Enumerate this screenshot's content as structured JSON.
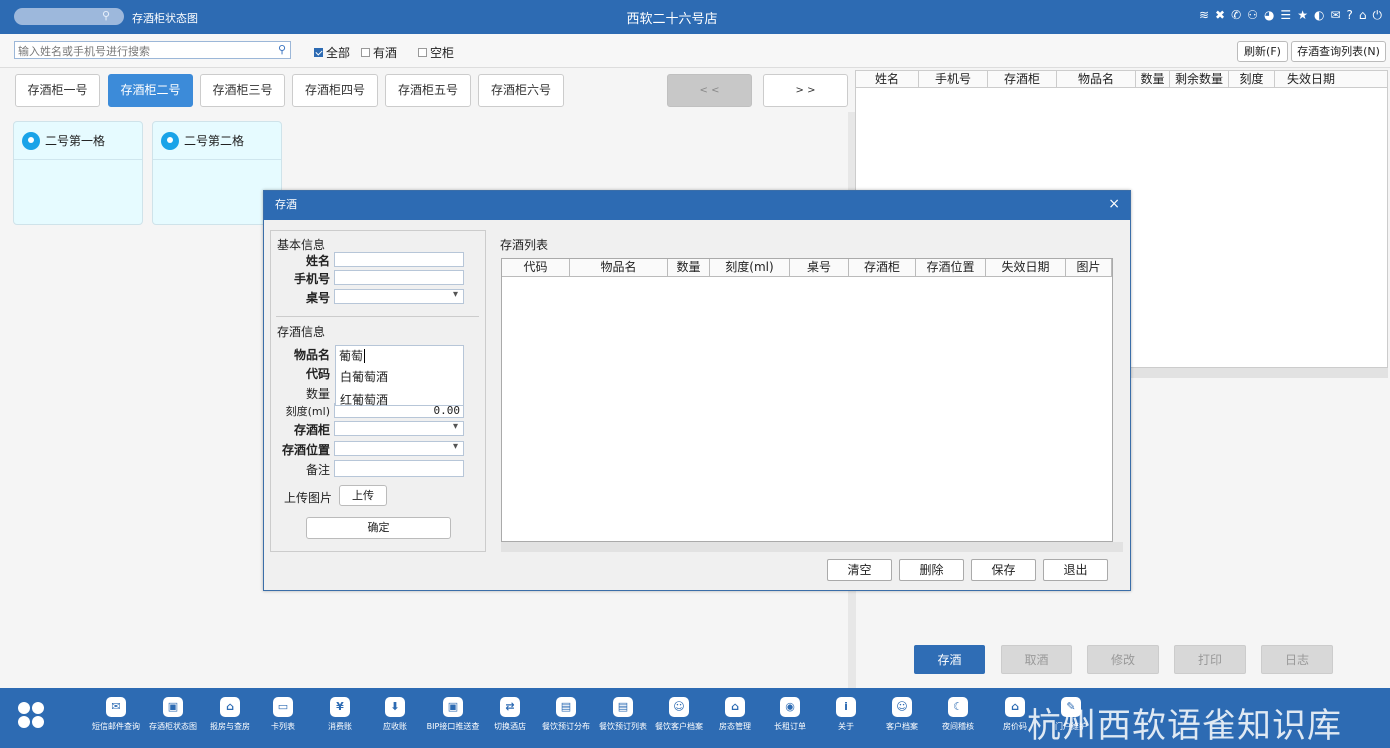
{
  "topbar": {
    "tab_title": "存酒柜状态图",
    "store_name": "西软二十六号店",
    "icons": [
      "wifi-icon",
      "tools-icon",
      "phone-icon",
      "user-icon",
      "palette-icon",
      "menu-icon",
      "star-icon",
      "contrast-icon",
      "mail-icon",
      "help-icon",
      "home-icon",
      "power-icon"
    ]
  },
  "filters": {
    "search_placeholder": "输入姓名或手机号进行搜索",
    "all_label": "全部",
    "has_wine_label": "有酒",
    "empty_label": "空柜",
    "refresh_label": "刷新(F)",
    "query_list_label": "存酒查询列表(N)"
  },
  "cabinet_tabs": [
    "存酒柜一号",
    "存酒柜二号",
    "存酒柜三号",
    "存酒柜四号",
    "存酒柜五号",
    "存酒柜六号"
  ],
  "nav": {
    "prev": "< <",
    "next": "> >"
  },
  "cells": [
    "二号第一格",
    "二号第二格"
  ],
  "right_table": {
    "columns": [
      "姓名",
      "手机号",
      "存酒柜",
      "物品名",
      "数量",
      "剩余数量",
      "刻度",
      "失效日期"
    ]
  },
  "actions": {
    "store": "存酒",
    "cancel": "取酒",
    "modify": "修改",
    "print": "打印",
    "log": "日志"
  },
  "dialog": {
    "title": "存酒",
    "basic_section": "基本信息",
    "name_label": "姓名",
    "phone_label": "手机号",
    "table_label": "桌号",
    "wine_section": "存酒信息",
    "item_label": "物品名",
    "item_value": "葡萄",
    "code_label": "代码",
    "qty_label": "数量",
    "scale_label": "刻度(ml)",
    "scale_value": "0.00",
    "cabinet_label": "存酒柜",
    "position_label": "存酒位置",
    "remark_label": "备注",
    "upload_label": "上传图片",
    "upload_button": "上传",
    "confirm_button": "确定",
    "suggestions": [
      "白葡萄酒",
      "红葡萄酒"
    ],
    "list_title": "存酒列表",
    "list_columns": [
      "代码",
      "物品名",
      "数量",
      "刻度(ml)",
      "桌号",
      "存酒柜",
      "存酒位置",
      "失效日期",
      "图片"
    ],
    "clear_button": "清空",
    "delete_button": "删除",
    "save_button": "保存",
    "exit_button": "退出"
  },
  "bottom_nav": [
    "短信邮件查询",
    "存酒柜状态图",
    "报房与查房",
    "卡列表",
    "消费账",
    "应收账",
    "BIP接口推送查",
    "切换酒店",
    "餐饮预订分布",
    "餐饮预订列表",
    "餐饮客户档案",
    "房态管理",
    "长租订单",
    "关于",
    "客户档案",
    "夜间稽核",
    "房价码",
    "门户维护"
  ],
  "watermark": "杭州西软语雀知识库"
}
